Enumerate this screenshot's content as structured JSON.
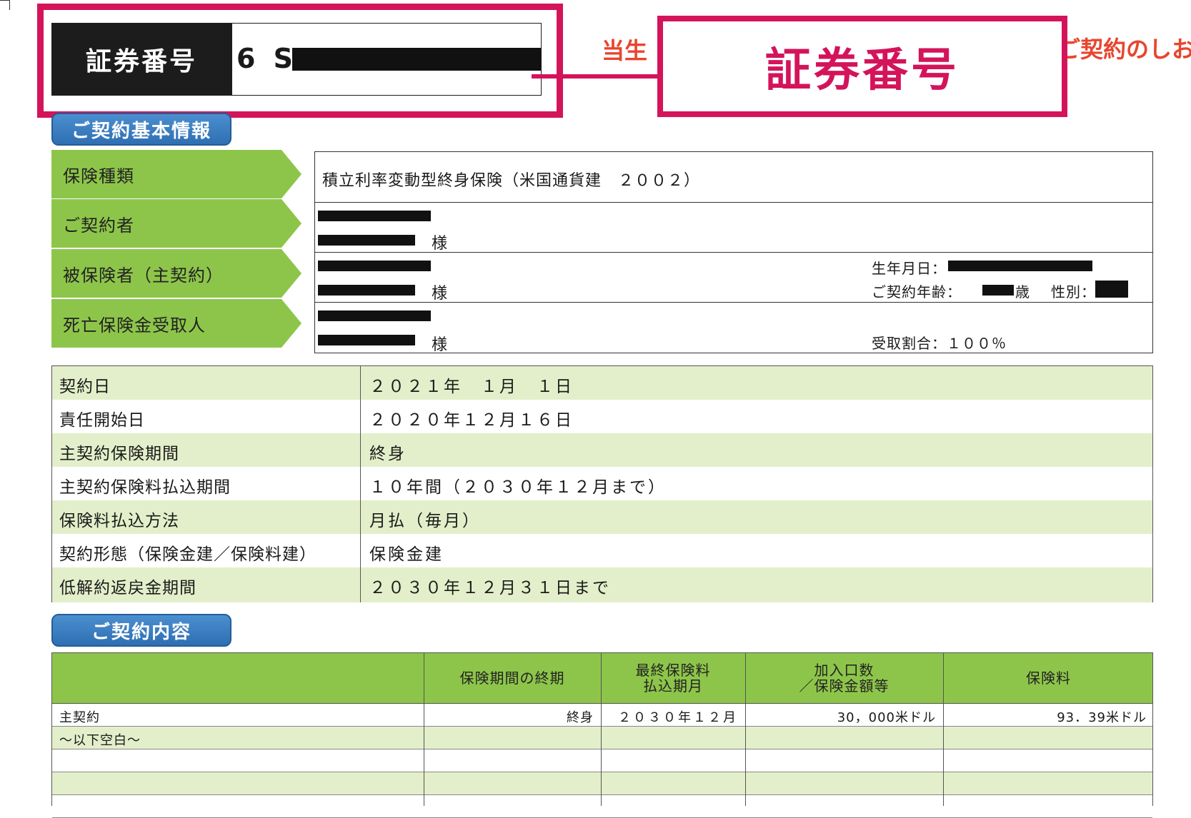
{
  "header": {
    "cert_label": "証券番号",
    "cert_value": "6 S",
    "callout_label": "証券番号",
    "red_text_left": "当生",
    "red_text_right": "ご契約のしお"
  },
  "basic_info": {
    "section_title": "ご契約基本情報",
    "rows": [
      {
        "label": "保険種類",
        "value": "積立利率変動型終身保険（米国通貨建　２００２）"
      },
      {
        "label": "ご契約者",
        "suffix": "様"
      },
      {
        "label": "被保険者（主契約）",
        "suffix": "様",
        "birth_label": "生年月日：",
        "age_label": "ご契約年齢：",
        "age_unit": "歳",
        "gender_label": "性別："
      },
      {
        "label": "死亡保険金受取人",
        "suffix": "様",
        "ratio_label": "受取割合：１００％"
      }
    ]
  },
  "contract_details": [
    {
      "label": "契約日",
      "value": "２０２１年　１月　１日"
    },
    {
      "label": "責任開始日",
      "value": "２０２０年１２月１６日"
    },
    {
      "label": "主契約保険期間",
      "value": "終身"
    },
    {
      "label": "主契約保険料払込期間",
      "value": "１０年間（２０３０年１２月まで）"
    },
    {
      "label": "保険料払込方法",
      "value": "月払（毎月）"
    },
    {
      "label": "契約形態（保険金建／保険料建）",
      "value": "保険金建"
    },
    {
      "label": "低解約返戻金期間",
      "value": "２０３０年１２月３１日まで"
    }
  ],
  "coverage": {
    "section_title": "ご契約内容",
    "columns": [
      {
        "label": ""
      },
      {
        "label": "保険期間の終期"
      },
      {
        "label_line1": "最終保険料",
        "label_line2": "払込期月"
      },
      {
        "label_line1": "加入口数",
        "label_line2": "／保険金額等"
      },
      {
        "label": "保険料"
      }
    ],
    "rows": [
      {
        "name": "主契約",
        "term_end": "終身",
        "last_payment": "２０３０年１２月",
        "amount": "30，000米ドル",
        "premium": "93．39米ドル"
      },
      {
        "name": "～以下空白～"
      }
    ]
  }
}
